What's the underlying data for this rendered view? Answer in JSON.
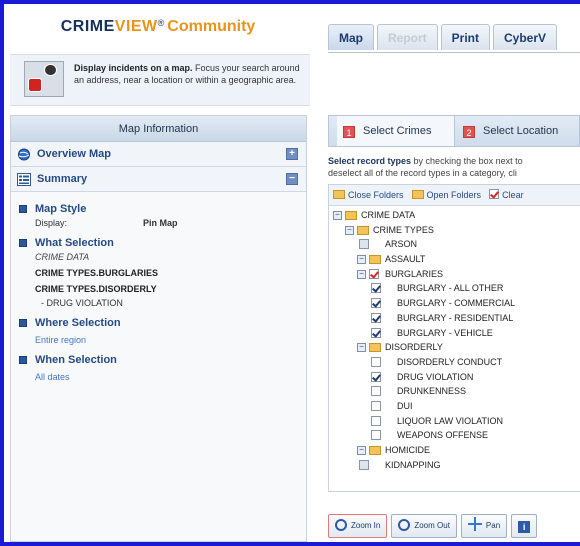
{
  "brand": {
    "crime": "CRIME",
    "view": "VIEW",
    "reg": "®",
    "community": "Community"
  },
  "intro": {
    "title": "Display incidents on a map.",
    "body": "Focus your search around an address, near a location or within a geographic area."
  },
  "tabs": [
    {
      "label": "Map"
    },
    {
      "label": "Report"
    },
    {
      "label": "Print"
    },
    {
      "label": "CyberV"
    }
  ],
  "panel": {
    "header": "Map Information",
    "overview": "Overview Map",
    "summary": "Summary",
    "overview_toggle": "+",
    "summary_toggle": "−"
  },
  "summary": {
    "map_style": {
      "title": "Map Style",
      "key": "Display:",
      "value": "Pin Map"
    },
    "what": {
      "title": "What Selection",
      "lines": [
        "CRIME DATA",
        "CRIME TYPES.BURGLARIES",
        "CRIME TYPES.DISORDERLY",
        "- DRUG VIOLATION"
      ]
    },
    "where": {
      "title": "Where Selection",
      "value": "Entire region"
    },
    "when": {
      "title": "When Selection",
      "value": "All dates"
    }
  },
  "select": {
    "tab1_num": "1",
    "tab1": "Select Crimes",
    "tab2_num": "2",
    "tab2": "Select Location"
  },
  "instructions": {
    "bold": "Select record types",
    "rest1": " by checking the box next to",
    "line2": "deselect all of the record types in a category, cli"
  },
  "tree_toolbar": {
    "close": "Close Folders",
    "open": "Open Folders",
    "clear": "Clear"
  },
  "tree": [
    {
      "label": "CRIME DATA",
      "level": 0,
      "kind": "folder"
    },
    {
      "label": "CRIME TYPES",
      "level": 1,
      "kind": "folder"
    },
    {
      "label": "ARSON",
      "level": 2,
      "kind": "leaf",
      "checked": false
    },
    {
      "label": "ASSAULT",
      "level": 2,
      "kind": "folder"
    },
    {
      "label": "BURGLARIES",
      "level": 2,
      "kind": "folder-checked"
    },
    {
      "label": "BURGLARY - ALL OTHER",
      "level": 3,
      "kind": "leaf",
      "checked": true
    },
    {
      "label": "BURGLARY - COMMERCIAL",
      "level": 3,
      "kind": "leaf",
      "checked": true
    },
    {
      "label": "BURGLARY - RESIDENTIAL",
      "level": 3,
      "kind": "leaf",
      "checked": true
    },
    {
      "label": "BURGLARY - VEHICLE",
      "level": 3,
      "kind": "leaf",
      "checked": true
    },
    {
      "label": "DISORDERLY",
      "level": 2,
      "kind": "folder"
    },
    {
      "label": "DISORDERLY CONDUCT",
      "level": 3,
      "kind": "leaf",
      "checked": false
    },
    {
      "label": "DRUG VIOLATION",
      "level": 3,
      "kind": "leaf",
      "checked": true
    },
    {
      "label": "DRUNKENNESS",
      "level": 3,
      "kind": "leaf",
      "checked": false
    },
    {
      "label": "DUI",
      "level": 3,
      "kind": "leaf",
      "checked": false
    },
    {
      "label": "LIQUOR LAW VIOLATION",
      "level": 3,
      "kind": "leaf",
      "checked": false
    },
    {
      "label": "WEAPONS OFFENSE",
      "level": 3,
      "kind": "leaf",
      "checked": false
    },
    {
      "label": "HOMICIDE",
      "level": 2,
      "kind": "folder"
    },
    {
      "label": "KIDNAPPING",
      "level": 2,
      "kind": "leaf",
      "checked": false
    }
  ],
  "map_tools": {
    "zoom_in": "Zoom In",
    "zoom_out": "Zoom Out",
    "pan": "Pan",
    "info": "i"
  },
  "colors": {
    "frame": "#1b1bd6",
    "brand_dark": "#15305a",
    "brand_orange": "#e8941c",
    "accent_blue": "#254a86",
    "badge_red": "#e25252"
  }
}
